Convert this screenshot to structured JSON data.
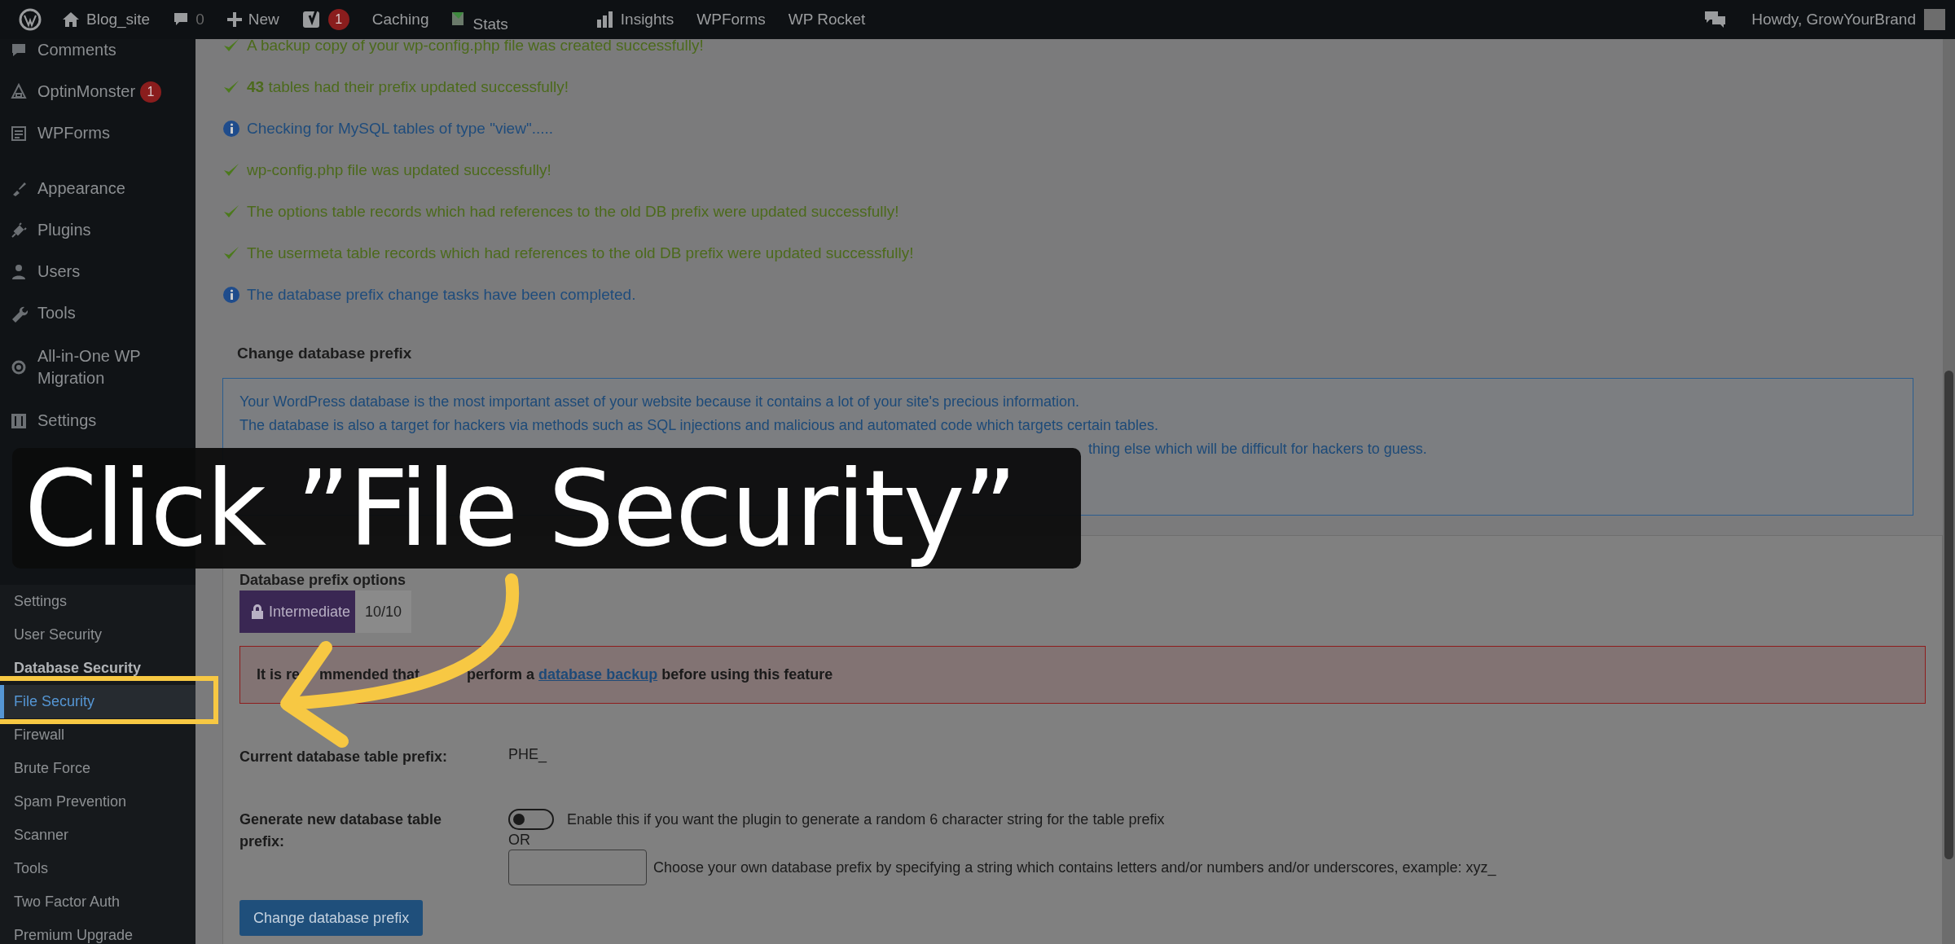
{
  "admin_bar": {
    "site": "Blog_site",
    "comments": "0",
    "new": "New",
    "yoast_badge": "1",
    "items": [
      "Caching",
      "Stats",
      "Insights",
      "WPForms",
      "WP Rocket"
    ],
    "greeting": "Howdy, GrowYourBrand"
  },
  "sidebar": {
    "items": [
      {
        "label": "Comments"
      },
      {
        "label": "OptinMonster",
        "badge": "1"
      },
      {
        "label": "WPForms"
      },
      {
        "label": "Appearance"
      },
      {
        "label": "Plugins"
      },
      {
        "label": "Users"
      },
      {
        "label": "Tools"
      },
      {
        "label": "All-in-One WP Migration"
      },
      {
        "label": "Settings"
      }
    ],
    "submenu": [
      {
        "label": "Settings",
        "selected": false,
        "bold": false
      },
      {
        "label": "User Security",
        "selected": false,
        "bold": false
      },
      {
        "label": "Database Security",
        "selected": false,
        "bold": true
      },
      {
        "label": "File Security",
        "selected": true,
        "bold": false
      },
      {
        "label": "Firewall",
        "selected": false,
        "bold": false
      },
      {
        "label": "Brute Force",
        "selected": false,
        "bold": false
      },
      {
        "label": "Spam Prevention",
        "selected": false,
        "bold": false
      },
      {
        "label": "Scanner",
        "selected": false,
        "bold": false
      },
      {
        "label": "Tools",
        "selected": false,
        "bold": false
      },
      {
        "label": "Two Factor Auth",
        "selected": false,
        "bold": false
      },
      {
        "label": "Premium Upgrade",
        "selected": false,
        "bold": false
      }
    ]
  },
  "messages": [
    {
      "kind": "success",
      "text": "A backup copy of your wp-config.php file was created successfully!"
    },
    {
      "kind": "success",
      "text": "**43** tables had their prefix updated successfully!"
    },
    {
      "kind": "info",
      "text": "Checking for MySQL tables of type \"view\"....."
    },
    {
      "kind": "success",
      "text": "wp-config.php file was updated successfully!"
    },
    {
      "kind": "success",
      "text": "The options table records which had references to the old DB prefix were updated successfully!"
    },
    {
      "kind": "success",
      "text": "The usermeta table records which had references to the old DB prefix were updated successfully!"
    },
    {
      "kind": "info",
      "text": "The database prefix change tasks have been completed."
    }
  ],
  "section_title": "Change database prefix",
  "info_box": {
    "lines": [
      "Your WordPress database is the most important asset of your website because it contains a lot of your site's precious information.",
      "The database is also a target for hackers via methods such as SQL injections and malicious and automated code which targets certain tables."
    ],
    "tail_fragment": "thing else which will be difficult for hackers to guess."
  },
  "options": {
    "title": "Database prefix options",
    "badge": "Intermediate",
    "score": "10/10",
    "warning": {
      "before": "It is re",
      "middle": "mmended that",
      "after_gap": "perform a",
      "link": "database backup",
      "after": "before using this feature"
    },
    "current_label": "Current database table prefix:",
    "current_value": "PHE_",
    "generate_label": "Generate new database table prefix:",
    "toggle": {
      "on": false,
      "label": "Enable this if you want the plugin to generate a random 6 character string for the table prefix"
    },
    "or": "OR",
    "custom_hint": "Choose your own database prefix by specifying a string which contains letters and/or numbers and/or underscores, example: xyz_",
    "button": "Change database prefix"
  },
  "callout": {
    "text": "Click ”File Security”"
  }
}
